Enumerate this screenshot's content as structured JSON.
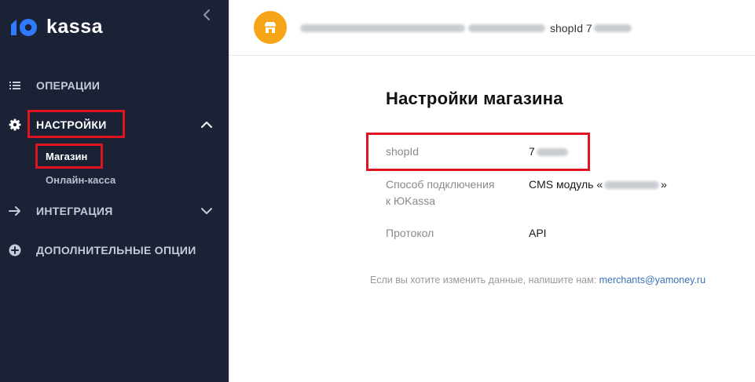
{
  "sidebar": {
    "logo_text": "kassa",
    "nav": {
      "operations": "ОПЕРАЦИИ",
      "settings": "НАСТРОЙКИ",
      "integration": "ИНТЕГРАЦИЯ",
      "extra_options": "ДОПОЛНИТЕЛЬНЫЕ ОПЦИИ"
    },
    "settings_children": {
      "shop": "Магазин",
      "online_kassa": "Онлайн-касса"
    }
  },
  "topbar": {
    "shop_id_label": "shopId 7"
  },
  "main": {
    "title": "Настройки магазина",
    "rows": [
      {
        "label": "shopId",
        "value": "7"
      },
      {
        "label_line1": "Способ подключения",
        "label_line2": "к ЮKassa",
        "value_prefix": "CMS модуль «",
        "value_suffix": "»"
      },
      {
        "label": "Протокол",
        "value": "API"
      }
    ],
    "note_text": "Если вы хотите изменить данные, напишите нам:",
    "note_email": "merchants@yamoney.ru"
  },
  "colors": {
    "sidebar_bg": "#1b2236",
    "highlight": "#e0141e",
    "avatar": "#f6a418",
    "link": "#3a72b8"
  }
}
